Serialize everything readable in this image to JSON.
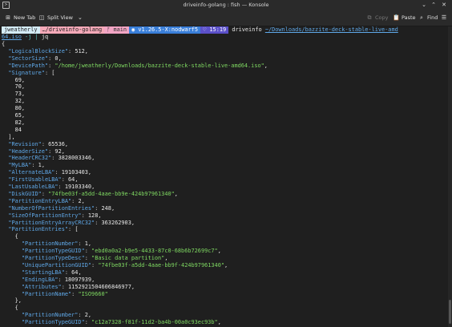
{
  "window": {
    "title": "driveinfo-golang : fish — Konsole",
    "app_icon": "terminal-icon",
    "controls": [
      "minimize-icon",
      "maximize-icon",
      "close-icon"
    ]
  },
  "toolbar": {
    "new_tab": "New Tab",
    "split_view": "Split View",
    "copy": "Copy",
    "paste": "Paste",
    "find": "Find"
  },
  "prompt": {
    "user": "jweatherly",
    "dir": "…/driveinfo-golang",
    "git": "main",
    "version": "v1.26.5-X:nodwarf5",
    "time": "15:19",
    "command": "driveinfo",
    "path": "~/Downloads/bazzite-deck-stable-live-amd",
    "path_cont": "64.iso",
    "flag": " -j",
    "pipe": " | ",
    "pipe_cmd": "jq"
  },
  "output": [
    {
      "t": "p",
      "text": "{"
    },
    {
      "i": 2,
      "key": "LogicalBlockSize",
      "val": "512",
      "comma": true
    },
    {
      "i": 2,
      "key": "SectorSize",
      "val": "0",
      "comma": true
    },
    {
      "i": 2,
      "key": "DevicePath",
      "str": "/home/jweatherly/Downloads/bazzite-deck-stable-live-amd64.iso",
      "comma": true
    },
    {
      "i": 2,
      "key": "Signature",
      "open": "["
    },
    {
      "i": 4,
      "num": "69,"
    },
    {
      "i": 4,
      "num": "70,"
    },
    {
      "i": 4,
      "num": "73,"
    },
    {
      "i": 4,
      "num": "32,"
    },
    {
      "i": 4,
      "num": "80,"
    },
    {
      "i": 4,
      "num": "65,"
    },
    {
      "i": 4,
      "num": "82,"
    },
    {
      "i": 4,
      "num": "84"
    },
    {
      "i": 2,
      "raw": "],"
    },
    {
      "i": 2,
      "key": "Revision",
      "val": "65536",
      "comma": true
    },
    {
      "i": 2,
      "key": "HeaderSize",
      "val": "92",
      "comma": true
    },
    {
      "i": 2,
      "key": "HeaderCRC32",
      "val": "3828003346",
      "comma": true
    },
    {
      "i": 2,
      "key": "MyLBA",
      "val": "1",
      "comma": true
    },
    {
      "i": 2,
      "key": "AlternateLBA",
      "val": "19103403",
      "comma": true
    },
    {
      "i": 2,
      "key": "FirstUsableLBA",
      "val": "64",
      "comma": true
    },
    {
      "i": 2,
      "key": "LastUsableLBA",
      "val": "19103340",
      "comma": true
    },
    {
      "i": 2,
      "key": "DiskGUID",
      "str": "74fbe03f-a5dd-4aae-bb9e-424b97961340",
      "comma": true
    },
    {
      "i": 2,
      "key": "PartitionEntryLBA",
      "val": "2",
      "comma": true
    },
    {
      "i": 2,
      "key": "NumberOfPartitionEntries",
      "val": "248",
      "comma": true
    },
    {
      "i": 2,
      "key": "SizeOfPartitionEntry",
      "val": "128",
      "comma": true
    },
    {
      "i": 2,
      "key": "PartitionEntryArrayCRC32",
      "val": "363262903",
      "comma": true
    },
    {
      "i": 2,
      "key": "PartitionEntries",
      "open": "["
    },
    {
      "i": 4,
      "raw": "{"
    },
    {
      "i": 6,
      "key": "PartitionNumber",
      "val": "1",
      "comma": true
    },
    {
      "i": 6,
      "key": "PartitionTypeGUID",
      "str": "ebd0a0a2-b9e5-4433-87c0-68b6b72699c7",
      "comma": true
    },
    {
      "i": 6,
      "key": "PartitionTypeDesc",
      "str": "Basic data partition",
      "comma": true
    },
    {
      "i": 6,
      "key": "UniquePartitionGUID",
      "str": "74fbe03f-a5dd-4aae-bb9f-424b97961340",
      "comma": true
    },
    {
      "i": 6,
      "key": "StartingLBA",
      "val": "64",
      "comma": true
    },
    {
      "i": 6,
      "key": "EndingLBA",
      "val": "18097939",
      "comma": true
    },
    {
      "i": 6,
      "key": "Attributes",
      "val": "1152921504606846977",
      "comma": true
    },
    {
      "i": 6,
      "key": "PartitionName",
      "str": "ISO9660",
      "comma": false
    },
    {
      "i": 4,
      "raw": "},"
    },
    {
      "i": 4,
      "raw": "{"
    },
    {
      "i": 6,
      "key": "PartitionNumber",
      "val": "2",
      "comma": true
    },
    {
      "i": 6,
      "key": "PartitionTypeGUID",
      "str": "c12a7328-f81f-11d2-ba4b-00a0c93ec93b",
      "comma": true
    }
  ]
}
